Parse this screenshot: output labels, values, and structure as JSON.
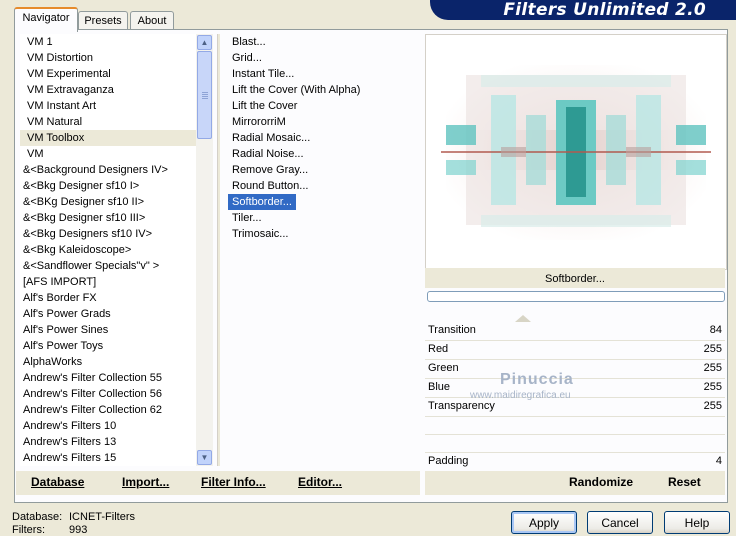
{
  "app": {
    "title": "Filters Unlimited 2.0"
  },
  "tabs": [
    {
      "label": "Navigator"
    },
    {
      "label": "Presets"
    },
    {
      "label": "About"
    }
  ],
  "categories": [
    "VM 1",
    "VM Distortion",
    "VM Experimental",
    "VM Extravaganza",
    "VM Instant Art",
    "VM Natural",
    "VM Toolbox",
    "VM",
    "&<Background Designers IV>",
    "&<Bkg Designer sf10 I>",
    "&<BKg Designer sf10 II>",
    "&<Bkg Designer sf10 III>",
    "&<Bkg Designers sf10 IV>",
    "&<Bkg Kaleidoscope>",
    "&<Sandflower Specials\"v\" >",
    "[AFS IMPORT]",
    "Alf's Border FX",
    "Alf's Power Grads",
    "Alf's Power Sines",
    "Alf's Power Toys",
    "AlphaWorks",
    "Andrew's Filter Collection 55",
    "Andrew's Filter Collection 56",
    "Andrew's Filter Collection 62",
    "Andrew's Filters 10",
    "Andrew's Filters 13",
    "Andrew's Filters 15"
  ],
  "selected_category": "VM Toolbox",
  "filters": [
    "Blast...",
    "Grid...",
    "Instant Tile...",
    "Lift the Cover (With Alpha)",
    "Lift the Cover",
    "MirrororriM",
    "Radial Mosaic...",
    "Radial Noise...",
    "Remove Gray...",
    "Round Button...",
    "Softborder...",
    "Tiler...",
    "Trimosaic..."
  ],
  "selected_filter": "Softborder...",
  "preview": {
    "filter_name": "Softborder..."
  },
  "params": [
    {
      "label": "Transition",
      "value": "84"
    },
    {
      "label": "Red",
      "value": "255"
    },
    {
      "label": "Green",
      "value": "255"
    },
    {
      "label": "Blue",
      "value": "255"
    },
    {
      "label": "Transparency",
      "value": "255"
    }
  ],
  "padding": {
    "label": "Padding",
    "value": "4"
  },
  "watermark": {
    "name": "Pinuccia",
    "url": "www.maidiregrafica.eu"
  },
  "toolbar": {
    "database": "Database",
    "import": "Import...",
    "filter_info": "Filter Info...",
    "editor": "Editor...",
    "randomize": "Randomize",
    "reset": "Reset"
  },
  "footer": {
    "database_label": "Database:",
    "database_value": "ICNET-Filters",
    "filters_label": "Filters:",
    "filters_value": "993"
  },
  "buttons": {
    "apply": "Apply",
    "cancel": "Cancel",
    "help": "Help"
  },
  "colors": {
    "selection": "#316ac5",
    "banner": "#0a246a",
    "tab_highlight": "#e68b2c"
  }
}
